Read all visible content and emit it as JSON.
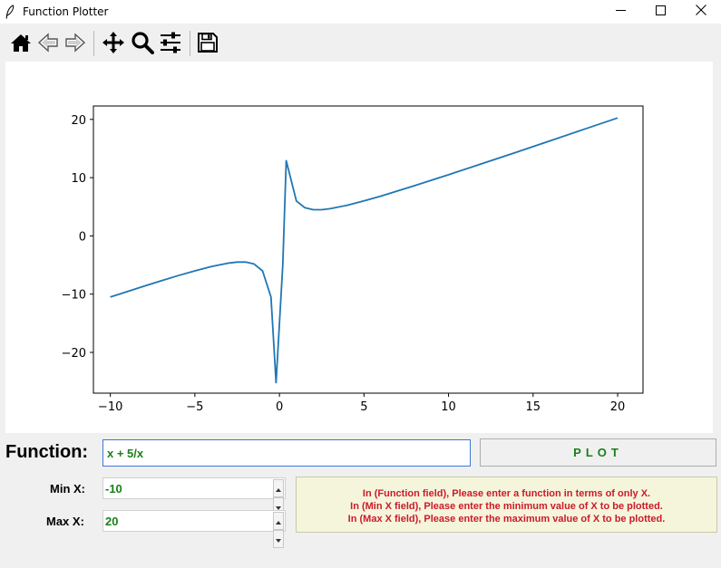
{
  "window": {
    "title": "Function Plotter",
    "icons": [
      "feather-icon",
      "minimize-icon",
      "maximize-icon",
      "close-icon"
    ]
  },
  "toolbar": {
    "buttons": [
      "home-icon",
      "back-arrow-icon",
      "forward-arrow-icon",
      "pan-icon",
      "zoom-icon",
      "configure-subplots-icon",
      "save-icon"
    ]
  },
  "chart_data": {
    "type": "line",
    "title": "",
    "xlabel": "",
    "ylabel": "",
    "xlim": [
      -11,
      21.5
    ],
    "ylim": [
      -27,
      22.3
    ],
    "x_ticks": [
      -10,
      -5,
      0,
      5,
      10,
      15,
      20
    ],
    "x_tick_labels": [
      "−10",
      "−5",
      "0",
      "5",
      "10",
      "15",
      "20"
    ],
    "y_ticks": [
      -20,
      -10,
      0,
      10,
      20
    ],
    "y_tick_labels": [
      "−20",
      "−10",
      "0",
      "10",
      "20"
    ],
    "grid": false,
    "color": "#1f77b4",
    "series": [
      {
        "x": [
          -10,
          -9,
          -8,
          -7,
          -6,
          -5,
          -4,
          -3,
          -2.5,
          -2,
          -1.5,
          -1,
          -0.5,
          -0.2,
          0.2,
          0.4,
          1,
          1.5,
          2,
          2.5,
          3,
          4,
          5,
          6,
          8,
          10,
          12,
          14,
          16,
          18,
          20
        ],
        "values": [
          -10.5,
          -9.56,
          -8.63,
          -7.71,
          -6.83,
          -6.0,
          -5.25,
          -4.67,
          -4.5,
          -4.5,
          -4.83,
          -6.0,
          -10.5,
          -25.2,
          -5.0,
          12.9,
          6.0,
          4.83,
          4.5,
          4.5,
          4.67,
          5.25,
          6.0,
          6.83,
          8.63,
          10.5,
          12.42,
          14.36,
          16.31,
          18.28,
          20.25
        ]
      }
    ]
  },
  "form": {
    "function_label": "Function:",
    "function_value": "x + 5/x",
    "plot_button": "PLOT",
    "min_label": "Min X:",
    "min_value": "-10",
    "max_label": "Max X:",
    "max_value": "20"
  },
  "help": {
    "lines": [
      "In (Function field), Please enter a function in terms of only X.",
      "In (Min X field), Please enter the minimum value of X to be plotted.",
      "In (Max X field), Please enter the maximum value of X to be plotted."
    ]
  }
}
